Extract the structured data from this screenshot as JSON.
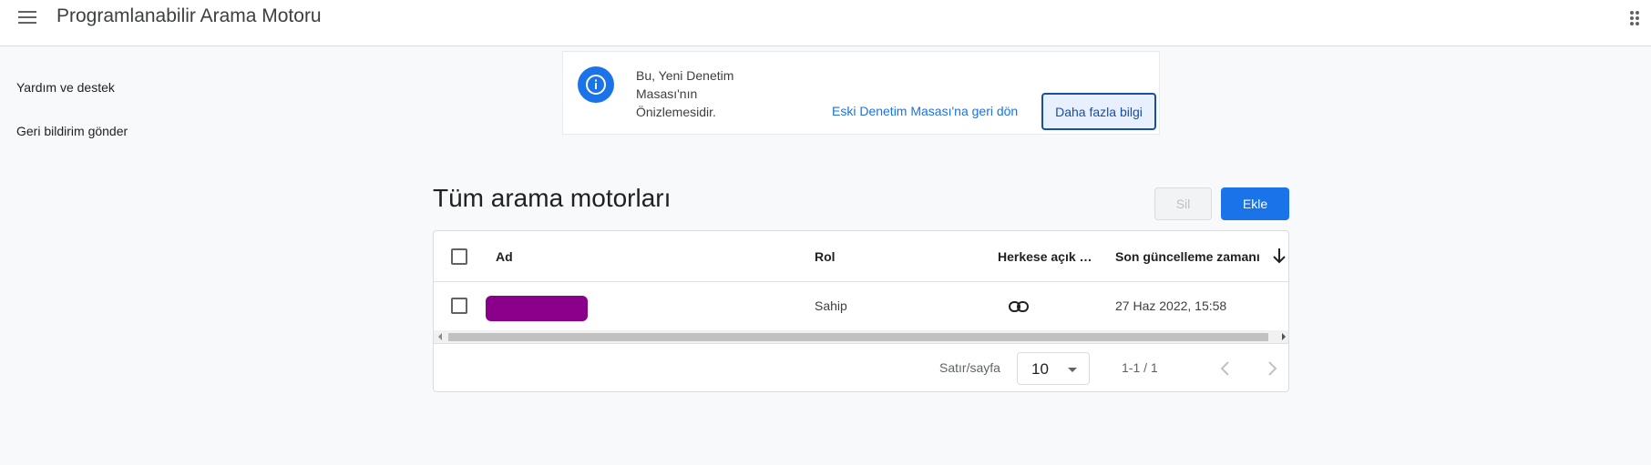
{
  "header": {
    "app_title": "Programlanabilir Arama Motoru",
    "menu_icon": "hamburger-menu-icon",
    "apps_icon": "more-vert-icon"
  },
  "sidebar": {
    "items": [
      {
        "label": "Yardım ve destek"
      },
      {
        "label": "Geri bildirim gönder"
      }
    ]
  },
  "banner": {
    "icon": "info-icon",
    "message": "Bu, Yeni Denetim Masası'nın Önizlemesidir.",
    "revert_link": "Eski Denetim Masası'na geri dön",
    "learn_more_button": "Daha fazla bilgi"
  },
  "main": {
    "title": "Tüm arama motorları",
    "delete_button": "Sil",
    "add_button": "Ekle",
    "table": {
      "columns": [
        "Ad",
        "Rol",
        "Herkese açık …",
        "Son güncelleme zamanı"
      ],
      "rows": [
        {
          "name": "",
          "role": "Sahip",
          "public_icon": "link-icon",
          "updated": "27 Haz 2022, 15:58"
        }
      ]
    },
    "pagination": {
      "rows_per_page_label": "Satır/sayfa",
      "rows_per_page_value": "10",
      "range": "1-1 / 1"
    }
  },
  "colors": {
    "primary": "#1a73e8",
    "redaction": "#8b008b"
  }
}
